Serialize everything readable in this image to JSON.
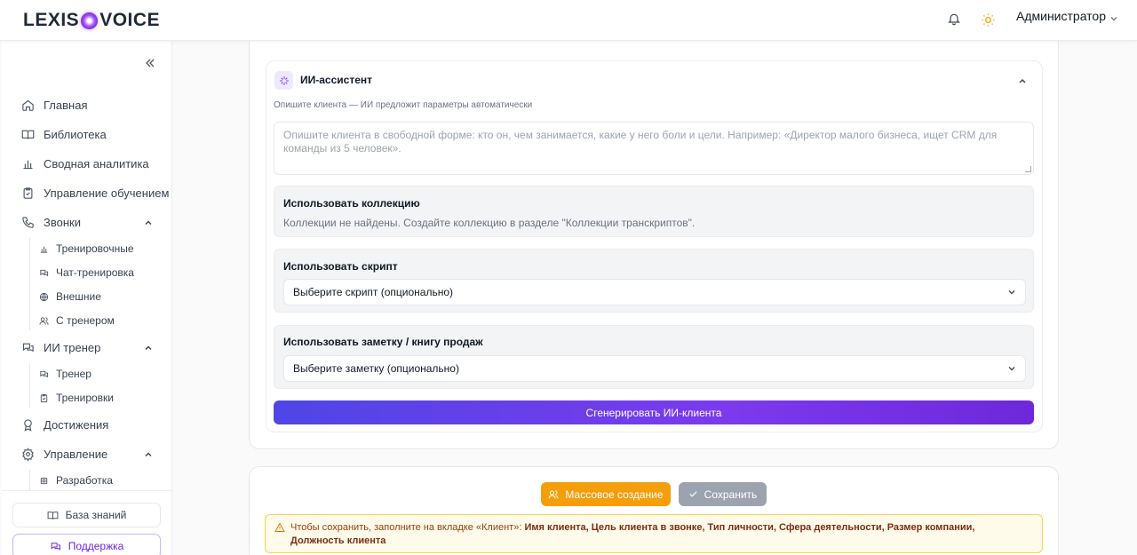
{
  "header": {
    "logo_left": "LEXIS",
    "logo_right": "VOICE",
    "user_name": "Администратор"
  },
  "sidebar": {
    "items": [
      {
        "label": "Главная",
        "icon": "home-icon"
      },
      {
        "label": "Библиотека",
        "icon": "book-icon"
      },
      {
        "label": "Сводная аналитика",
        "icon": "bar-chart-icon"
      },
      {
        "label": "Управление обучением",
        "icon": "clipboard-icon"
      },
      {
        "label": "Звонки",
        "icon": "phone-icon",
        "expanded": true
      },
      {
        "label": "ИИ тренер",
        "icon": "chat-icon",
        "expanded": true
      },
      {
        "label": "Достижения",
        "icon": "award-icon"
      },
      {
        "label": "Управление",
        "icon": "gear-icon",
        "expanded": true
      }
    ],
    "calls_sub": [
      {
        "label": "Тренировочные",
        "icon": "bar-chart-icon"
      },
      {
        "label": "Чат-тренировка",
        "icon": "chat-icon"
      },
      {
        "label": "Внешние",
        "icon": "globe-icon"
      },
      {
        "label": "С тренером",
        "icon": "users-icon"
      }
    ],
    "ai_trainer_sub": [
      {
        "label": "Тренер",
        "icon": "chat-icon"
      },
      {
        "label": "Тренировки",
        "icon": "clipboard-icon"
      }
    ],
    "management_sub": [
      {
        "label": "Разработка",
        "icon": "cpu-icon"
      }
    ],
    "knowledge_base": "База знаний",
    "support": "Поддержка"
  },
  "ai_assistant": {
    "title": "ИИ-ассистент",
    "hint": "Опишите клиента — ИИ предложит параметры автоматически",
    "textarea_placeholder": "Опишите клиента в свободной форме: кто он, чем занимается, какие у него боли и цели. Например: «Директор малого бизнеса, ищет CRM для команды из 5 человек».",
    "collection": {
      "title": "Использовать коллекцию",
      "empty_text": "Коллекции не найдены. Создайте коллекцию в разделе \"Коллекции транскриптов\"."
    },
    "script": {
      "title": "Использовать скрипт",
      "placeholder": "Выберите скрипт (опционально)"
    },
    "note": {
      "title": "Использовать заметку / книгу продаж",
      "placeholder": "Выберите заметку (опционально)"
    },
    "generate_button": "Сгенерировать ИИ-клиента"
  },
  "actions": {
    "mass_create": "Массовое создание",
    "save": "Сохранить"
  },
  "warning": {
    "prefix": "Чтобы сохранить, заполните на вкладке «Клиент»:",
    "fields": "Имя клиента, Цель клиента в звонке, Тип личности, Сфера деятельности, Размер компании, Должность клиента"
  },
  "colors": {
    "accent": "#6d28d9",
    "generate_gradient_start": "#4f46e5",
    "generate_gradient_end": "#7c3aed",
    "mass_create": "#f59e0b",
    "save_disabled": "#9ca3af",
    "warning_bg": "#fffbeb",
    "warning_border": "#fcd34d"
  }
}
